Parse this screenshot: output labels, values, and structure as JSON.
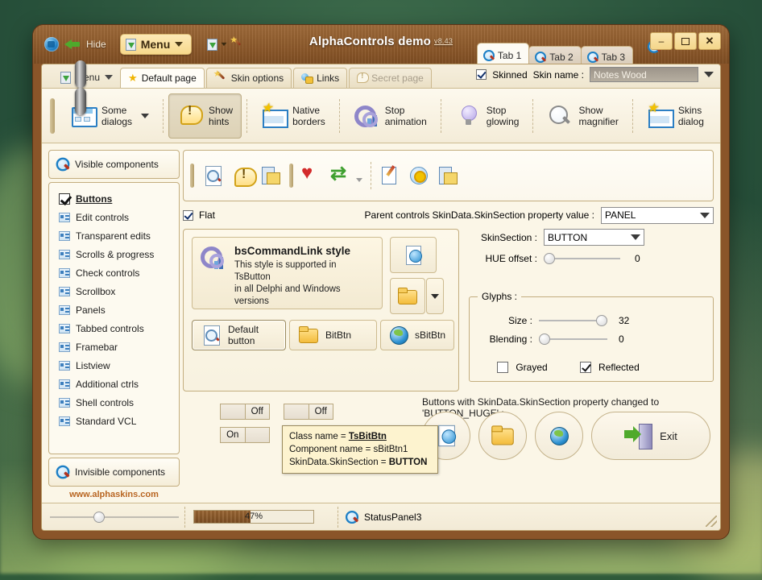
{
  "window": {
    "title": "AlphaControls demo",
    "version": "v8.43",
    "hide_label": "Hide",
    "menu_button": "Menu",
    "buttons": {
      "minimize": "–",
      "maximize": "❐",
      "close": "✕"
    },
    "icons": {
      "logo": "alphacontrols-logo-icon",
      "hide_arrow": "back-arrow-icon",
      "menu_glyph": "save-down-icon",
      "split_glyph": "save-down-icon",
      "wand": "magic-wand-icon"
    }
  },
  "top_tabs": [
    {
      "label": "Tab 1",
      "active": true
    },
    {
      "label": "Tab 2",
      "active": false
    },
    {
      "label": "Tab 3",
      "active": false
    }
  ],
  "skin": {
    "skinned_label": "Skinned",
    "skinned_checked": true,
    "name_label": "Skin name :",
    "name_value": "Notes Wood"
  },
  "page_tabs": {
    "menu_label": "Menu",
    "items": [
      {
        "label": "Default page",
        "icon": "star-icon",
        "state": "active"
      },
      {
        "label": "Skin options",
        "icon": "magic-wand-icon",
        "state": "normal"
      },
      {
        "label": "Links",
        "icon": "links-icon",
        "state": "normal"
      },
      {
        "label": "Secret page",
        "icon": "hint-icon",
        "state": "disabled"
      }
    ]
  },
  "big_toolbar": [
    {
      "label": "Some\ndialogs",
      "icon": "dialog-window-icon",
      "pressed": false,
      "has_dropdown": true
    },
    {
      "label": "Show\nhints",
      "icon": "hint-balloon-icon",
      "pressed": true,
      "has_dropdown": false
    },
    {
      "label": "Native\nborders",
      "icon": "window-star-icon",
      "pressed": false,
      "has_dropdown": false
    },
    {
      "label": "Stop\nanimation",
      "icon": "gears-icon",
      "pressed": false,
      "has_dropdown": false
    },
    {
      "label": "Stop\nglowing",
      "icon": "lightbulb-icon",
      "pressed": false,
      "has_dropdown": false
    },
    {
      "label": "Show\nmagnifier",
      "icon": "magnifier-icon",
      "pressed": false,
      "has_dropdown": false
    },
    {
      "label": "Skins\ndialog",
      "icon": "window-star-icon",
      "pressed": false,
      "has_dropdown": false
    }
  ],
  "small_toolbar": {
    "group1": [
      "magnifier-icon",
      "hint-balloon-icon",
      "print-icon"
    ],
    "group2": [
      "heart-icon",
      "refresh-icon"
    ],
    "group3": [
      "edit-pencil-icon",
      "settings-gear-icon",
      "print-icon"
    ]
  },
  "sidebar": {
    "header": {
      "label": "Visible components",
      "icon": "magnifier-icon"
    },
    "footer": {
      "label": "Invisible components",
      "icon": "magnifier-icon"
    },
    "url": "www.alphaskins.com",
    "items": [
      {
        "label": "Buttons",
        "selected": true
      },
      {
        "label": "Edit controls",
        "selected": false
      },
      {
        "label": "Transparent edits",
        "selected": false
      },
      {
        "label": "Scrolls & progress",
        "selected": false
      },
      {
        "label": "Check controls",
        "selected": false
      },
      {
        "label": "Scrollbox",
        "selected": false
      },
      {
        "label": "Panels",
        "selected": false
      },
      {
        "label": "Tabbed controls",
        "selected": false
      },
      {
        "label": "Framebar",
        "selected": false
      },
      {
        "label": "Listview",
        "selected": false
      },
      {
        "label": "Additional ctrls",
        "selected": false
      },
      {
        "label": "Shell controls",
        "selected": false
      },
      {
        "label": "Standard VCL",
        "selected": false
      }
    ]
  },
  "options": {
    "flat_label": "Flat",
    "flat_checked": true,
    "parent_label": "Parent controls SkinData.SkinSection property value :",
    "parent_value": "PANEL"
  },
  "command_link": {
    "title": "bsCommandLink style",
    "description": "This style is supported in TsButton\nin all Delphi and Windows versions",
    "icon": "gears-icon"
  },
  "demo_buttons": {
    "square_doc": "globe-document-icon",
    "square_folder": "folder-icon",
    "row": [
      {
        "label": "Default\nbutton",
        "icon": "document-search-icon"
      },
      {
        "label": "BitBtn",
        "icon": "folder-icon"
      },
      {
        "label": "sBitBtn",
        "icon": "globe-icon"
      }
    ]
  },
  "tooltip": {
    "line1_label": "Class name = ",
    "line1_value": "TsBitBtn",
    "line2_label": "Component name = ",
    "line2_value": "sBitBtn1",
    "line3_label": "SkinData.SkinSection = ",
    "line3_value": "BUTTON"
  },
  "toggles": [
    {
      "left": "",
      "right": "Off",
      "active": "right"
    },
    {
      "left": "",
      "right": "Off",
      "active": "right"
    },
    {
      "left": "On",
      "right": "",
      "active": "left"
    },
    {
      "left": "On",
      "right": "",
      "active": "left"
    }
  ],
  "properties": {
    "skinsection_label": "SkinSection :",
    "skinsection_value": "BUTTON",
    "hue_label": "HUE offset :",
    "hue_value": "0",
    "hue_percent": 2,
    "glyphs_caption": "Glyphs :",
    "size_label": "Size :",
    "size_value": "32",
    "size_percent": 97,
    "blending_label": "Blending :",
    "blending_value": "0",
    "blending_percent": 2,
    "grayed_label": "Grayed",
    "grayed_checked": false,
    "reflected_label": "Reflected",
    "reflected_checked": true
  },
  "huge": {
    "label": "Buttons with SkinData.SkinSection property changed to 'BUTTON_HUGE' :",
    "buttons": [
      {
        "icon": "globe-document-icon",
        "label": ""
      },
      {
        "icon": "folder-icon",
        "label": ""
      },
      {
        "icon": "globe-icon",
        "label": ""
      },
      {
        "icon": "exit-door-icon",
        "label": "Exit"
      }
    ]
  },
  "statusbar": {
    "slider_percent": 35,
    "progress_percent": 47,
    "progress_text": "47%",
    "panel3_label": "StatusPanel3",
    "panel3_icon": "magnifier-icon"
  },
  "colors": {
    "wood": "#8a5529",
    "client_bg": "#fbf6e7",
    "accent": "#b8651f",
    "tooltip_bg": "#fdf3cf"
  }
}
